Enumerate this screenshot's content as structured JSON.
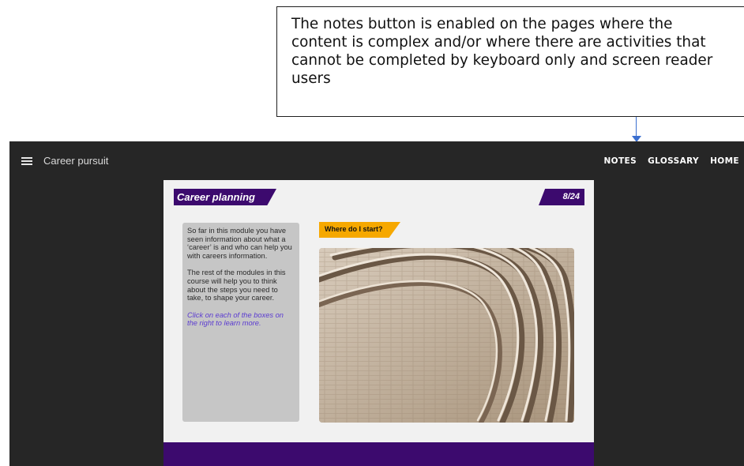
{
  "annotation": {
    "text": "The notes button is enabled on the pages where the content is complex and/or where there are activities that cannot be completed by keyboard only and screen reader users"
  },
  "app": {
    "title": "Career pursuit",
    "nav": {
      "notes": "NOTES",
      "glossary": "GLOSSARY",
      "home": "HOME"
    }
  },
  "slide": {
    "title": "Career planning",
    "page": "8/24",
    "text": {
      "p1": "So far in this module you have seen information about what a ‘career’ is and who can help you with careers information.",
      "p2": "The rest of the modules in this course will help you to think about the steps you need to take, to shape your career.",
      "hint": "Click on each of the boxes on the right to learn more."
    },
    "tab_label": "Where do I start?",
    "image_description": "curved stone steps"
  },
  "colors": {
    "frame": "#262626",
    "brand_purple": "#3c0a6e",
    "accent_orange": "#f6a800",
    "hint_text": "#5b3bd1",
    "arrow": "#3b6fd0"
  }
}
